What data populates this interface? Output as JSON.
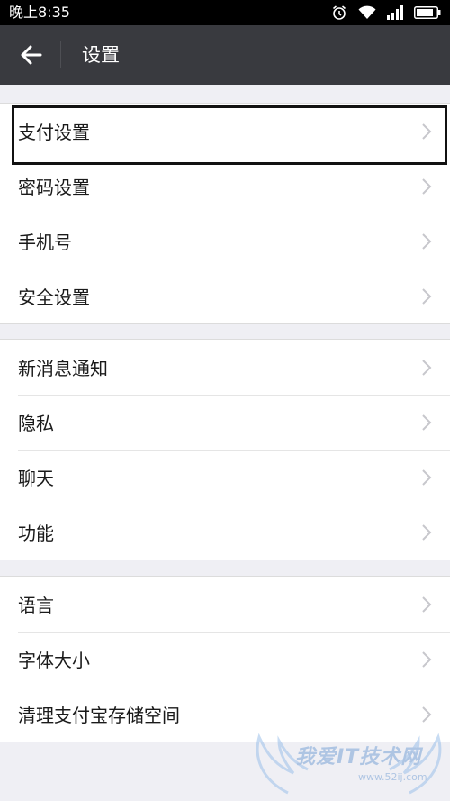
{
  "status_bar": {
    "time": "晚上8:35",
    "icons": [
      "alarm-icon",
      "wifi-icon",
      "signal-icon",
      "battery-icon"
    ]
  },
  "header": {
    "title": "设置",
    "back_icon": "arrow-left-icon"
  },
  "groups": [
    {
      "items": [
        "支付设置",
        "密码设置",
        "手机号",
        "安全设置"
      ]
    },
    {
      "items": [
        "新消息通知",
        "隐私",
        "聊天",
        "功能"
      ]
    },
    {
      "items": [
        "语言",
        "字体大小",
        "清理支付宝存储空间"
      ]
    }
  ],
  "highlighted_item": "支付设置",
  "watermark": {
    "text": "我爱IT技术网",
    "url": "www.52ij.com"
  },
  "colors": {
    "status_bar": "#000000",
    "nav_bar": "#393a3f",
    "page_background": "#efeff4",
    "row_background": "#ffffff",
    "chevron": "#c7c7cc"
  }
}
